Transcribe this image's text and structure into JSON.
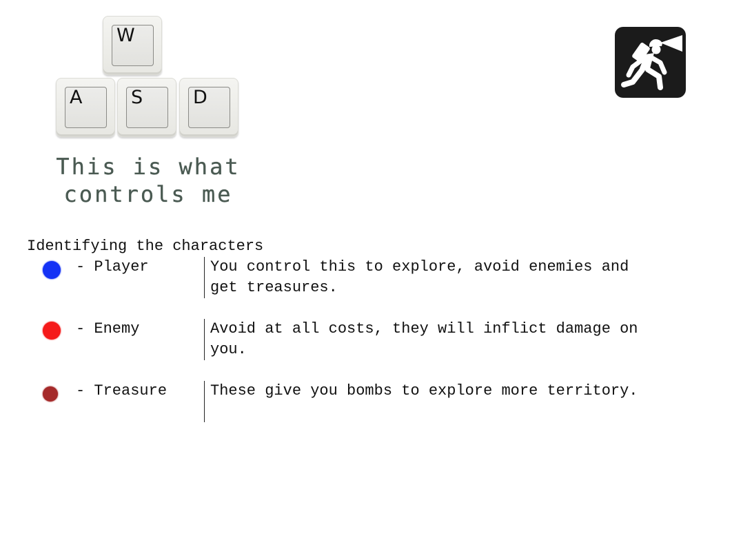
{
  "controls": {
    "keys": {
      "w": "W",
      "a": "A",
      "s": "S",
      "d": "D"
    },
    "caption_line1": "This is what",
    "caption_line2": "controls me"
  },
  "icon": {
    "name": "explorer-with-headlamp-icon"
  },
  "legend": {
    "heading": "Identifying the characters",
    "rows": [
      {
        "label": "- Player",
        "color": "#1432f5",
        "description_line1": "You control this to explore, avoid enemies and",
        "description_line2": "get treasures."
      },
      {
        "label": "- Enemy",
        "color": "#f51a1a",
        "description_line1": "Avoid at all costs, they will inflict damage on",
        "description_line2": "you."
      },
      {
        "label": "- Treasure",
        "color": "#a52a2a",
        "description_line1": "These give you bombs to explore more territory.",
        "description_line2": ""
      }
    ]
  }
}
